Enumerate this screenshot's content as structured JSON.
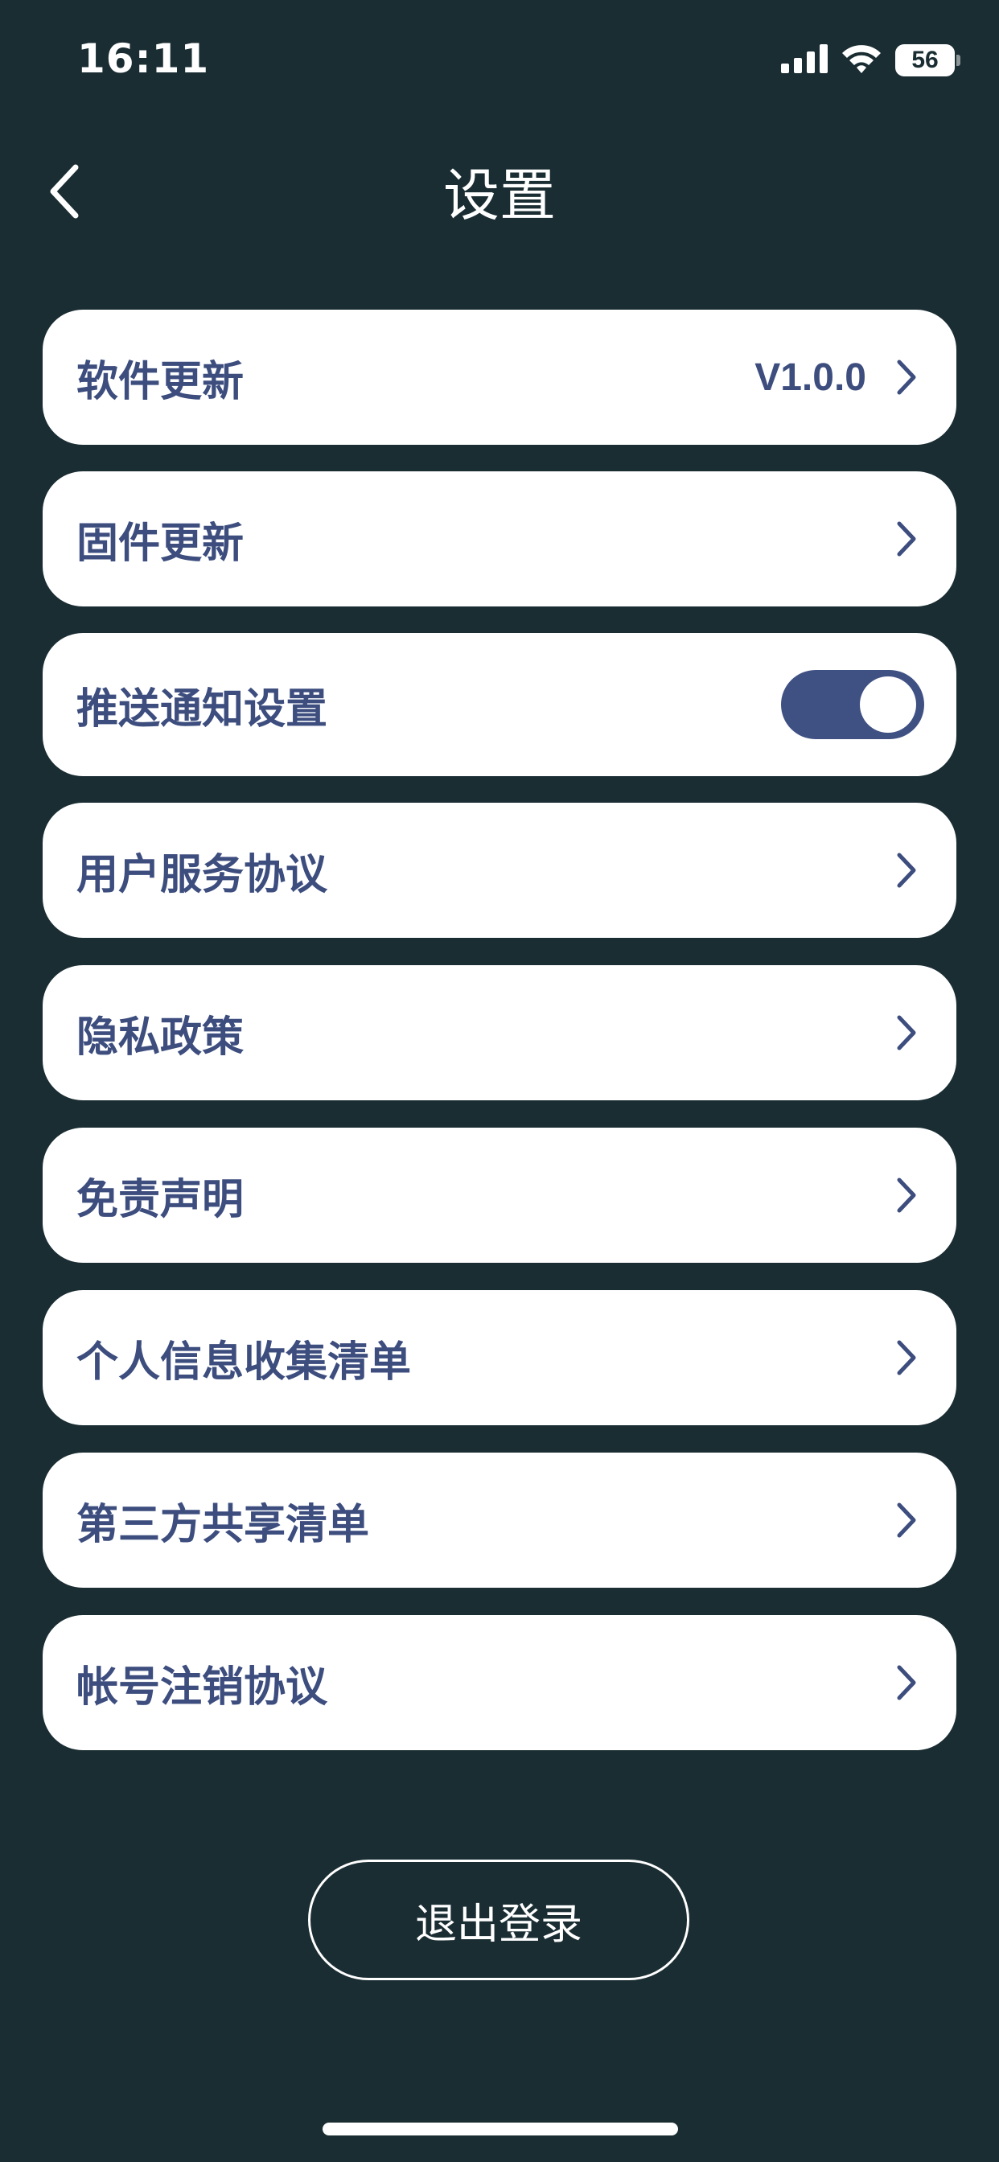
{
  "status_bar": {
    "time": "16:11",
    "battery": "56",
    "icons": [
      "signal-icon",
      "wifi-icon",
      "battery-icon"
    ]
  },
  "header": {
    "title": "设置",
    "back_icon": "chevron-left-icon"
  },
  "settings": {
    "software_update": {
      "label": "软件更新",
      "value": "V1.0.0"
    },
    "firmware_update": {
      "label": "固件更新"
    },
    "push_notifications": {
      "label": "推送通知设置",
      "enabled": true
    },
    "user_agreement": {
      "label": "用户服务协议"
    },
    "privacy_policy": {
      "label": "隐私政策"
    },
    "disclaimer": {
      "label": "免责声明"
    },
    "personal_info_list": {
      "label": "个人信息收集清单"
    },
    "third_party_list": {
      "label": "第三方共享清单"
    },
    "account_cancellation": {
      "label": "帐号注销协议"
    }
  },
  "logout": {
    "label": "退出登录"
  },
  "colors": {
    "background": "#1a2d33",
    "card": "#ffffff",
    "accent_text": "#3c4d7e",
    "toggle_on": "#3f5083"
  }
}
